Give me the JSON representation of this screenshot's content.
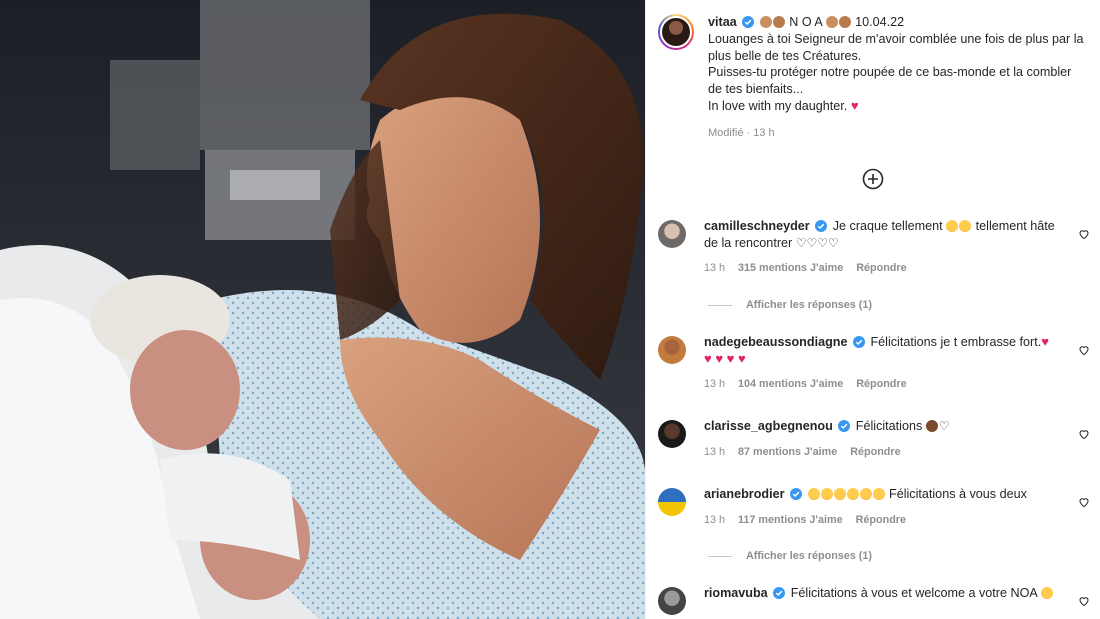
{
  "post": {
    "username": "vitaa",
    "title_text": "N O A",
    "date": "10.04.22",
    "line1": "Louanges à toi Seigneur de m'avoir comblée une fois de plus par la plus belle de tes Créatures.",
    "line2": "Puisses-tu protéger notre poupée de ce bas-monde et la combler de tes bienfaits...",
    "line3": "In love with my daughter.",
    "edited": "Modifié",
    "time": "13 h"
  },
  "comments": [
    {
      "username": "camilleschneyder",
      "text_a": "Je craque tellement",
      "text_b": "tellement hâte de la rencontrer",
      "time": "13 h",
      "likes": "315 mentions J'aime",
      "reply": "Répondre",
      "view_replies": "Afficher les réponses (1)"
    },
    {
      "username": "nadegebeaussondiagne",
      "text_a": "Félicitations je t embrasse fort.",
      "time": "13 h",
      "likes": "104 mentions J'aime",
      "reply": "Répondre"
    },
    {
      "username": "clarisse_agbegnenou",
      "text_a": "Félicitations",
      "time": "13 h",
      "likes": "87 mentions J'aime",
      "reply": "Répondre"
    },
    {
      "username": "arianebrodier",
      "text_a": "Félicitations à vous deux",
      "time": "13 h",
      "likes": "117 mentions J'aime",
      "reply": "Répondre",
      "view_replies": "Afficher les réponses (1)"
    },
    {
      "username": "riomavuba",
      "text_a": "Félicitations à vous et welcome a votre NOA"
    }
  ],
  "icons": {
    "verified": "verified-badge-icon",
    "like": "heart-outline-icon",
    "more": "plus-circle-icon"
  },
  "colors": {
    "verified": "#3897f0",
    "heart": "#e0245e",
    "muted": "#8e8e8e"
  }
}
